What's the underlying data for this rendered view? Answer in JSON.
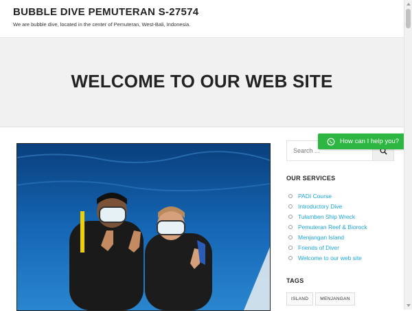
{
  "header": {
    "title": "BUBBLE DIVE PEMUTERAN S-27574",
    "tagline": "We are bubble dive, located in the center of Pemuteran, West-Bali, Indonesia."
  },
  "hero": {
    "title": "WELCOME TO OUR WEB SITE"
  },
  "search": {
    "placeholder": "Search ..."
  },
  "chat": {
    "label": "How can I help you?",
    "color": "#2db742"
  },
  "services": {
    "title": "OUR SERVICES",
    "items": [
      "PADI Course",
      "Introductory Dive",
      "Tulamben Ship Wreck",
      "Pemuteran Reef & Biorock",
      "Menjangan Island",
      "Friends of Diver",
      "Welcome to our web site"
    ],
    "link_color": "#1ba5d8"
  },
  "tags": {
    "title": "TAGS",
    "items": [
      "ISLAND",
      "MENJANGAN"
    ]
  }
}
